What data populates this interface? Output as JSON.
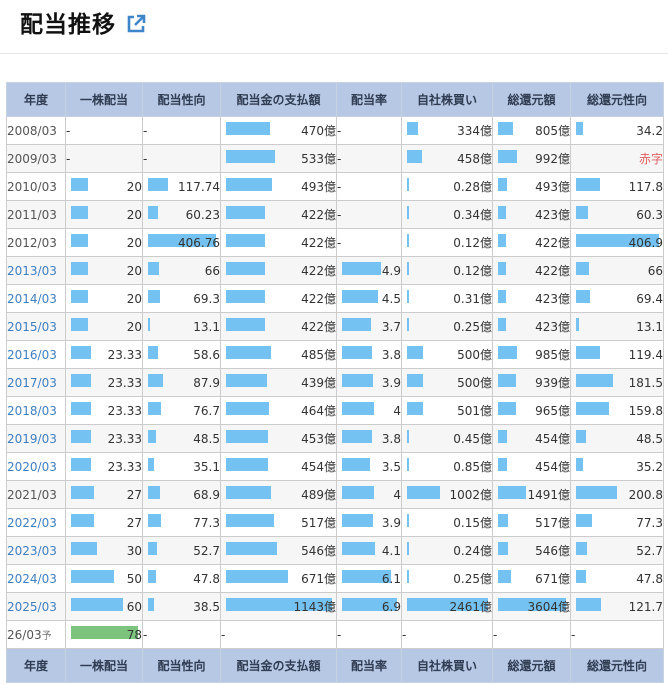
{
  "title": "配当推移",
  "headers": [
    "年度",
    "一株配当",
    "配当性向",
    "配当金の支払額",
    "配当率",
    "自社株買い",
    "総還元額",
    "総還元性向"
  ],
  "max": {
    "dps": 78,
    "payout": 406.76,
    "paid": 1143,
    "yield": 6.9,
    "buyback": 2461,
    "total": 3604,
    "tpayout": 406.9
  },
  "rows": [
    {
      "year": "2008/03",
      "link": false,
      "dps": "-",
      "payout": "-",
      "paid": "470億",
      "yield": "-",
      "buyback": "334億",
      "total": "805億",
      "tpayout": "34.2"
    },
    {
      "year": "2009/03",
      "link": false,
      "dps": "-",
      "payout": "-",
      "paid": "533億",
      "yield": "-",
      "buyback": "458億",
      "total": "992億",
      "tpayout": "赤字"
    },
    {
      "year": "2010/03",
      "link": false,
      "dps": "20",
      "payout": "117.74",
      "paid": "493億",
      "yield": "-",
      "buyback": "0.28億",
      "total": "493億",
      "tpayout": "117.8"
    },
    {
      "year": "2011/03",
      "link": false,
      "dps": "20",
      "payout": "60.23",
      "paid": "422億",
      "yield": "-",
      "buyback": "0.34億",
      "total": "423億",
      "tpayout": "60.3"
    },
    {
      "year": "2012/03",
      "link": false,
      "dps": "20",
      "payout": "406.76",
      "paid": "422億",
      "yield": "-",
      "buyback": "0.12億",
      "total": "422億",
      "tpayout": "406.9"
    },
    {
      "year": "2013/03",
      "link": true,
      "dps": "20",
      "payout": "66",
      "paid": "422億",
      "yield": "4.9",
      "buyback": "0.12億",
      "total": "422億",
      "tpayout": "66"
    },
    {
      "year": "2014/03",
      "link": true,
      "dps": "20",
      "payout": "69.3",
      "paid": "422億",
      "yield": "4.5",
      "buyback": "0.31億",
      "total": "423億",
      "tpayout": "69.4"
    },
    {
      "year": "2015/03",
      "link": true,
      "dps": "20",
      "payout": "13.1",
      "paid": "422億",
      "yield": "3.7",
      "buyback": "0.25億",
      "total": "423億",
      "tpayout": "13.1"
    },
    {
      "year": "2016/03",
      "link": true,
      "dps": "23.33",
      "payout": "58.6",
      "paid": "485億",
      "yield": "3.8",
      "buyback": "500億",
      "total": "985億",
      "tpayout": "119.4"
    },
    {
      "year": "2017/03",
      "link": true,
      "dps": "23.33",
      "payout": "87.9",
      "paid": "439億",
      "yield": "3.9",
      "buyback": "500億",
      "total": "939億",
      "tpayout": "181.5"
    },
    {
      "year": "2018/03",
      "link": true,
      "dps": "23.33",
      "payout": "76.7",
      "paid": "464億",
      "yield": "4",
      "buyback": "501億",
      "total": "965億",
      "tpayout": "159.8"
    },
    {
      "year": "2019/03",
      "link": true,
      "dps": "23.33",
      "payout": "48.5",
      "paid": "453億",
      "yield": "3.8",
      "buyback": "0.45億",
      "total": "454億",
      "tpayout": "48.5"
    },
    {
      "year": "2020/03",
      "link": true,
      "dps": "23.33",
      "payout": "35.1",
      "paid": "454億",
      "yield": "3.5",
      "buyback": "0.85億",
      "total": "454億",
      "tpayout": "35.2"
    },
    {
      "year": "2021/03",
      "link": false,
      "dps": "27",
      "payout": "68.9",
      "paid": "489億",
      "yield": "4",
      "buyback": "1002億",
      "total": "1491億",
      "tpayout": "200.8"
    },
    {
      "year": "2022/03",
      "link": true,
      "dps": "27",
      "payout": "77.3",
      "paid": "517億",
      "yield": "3.9",
      "buyback": "0.15億",
      "total": "517億",
      "tpayout": "77.3"
    },
    {
      "year": "2023/03",
      "link": true,
      "dps": "30",
      "payout": "52.7",
      "paid": "546億",
      "yield": "4.1",
      "buyback": "0.24億",
      "total": "546億",
      "tpayout": "52.7"
    },
    {
      "year": "2024/03",
      "link": true,
      "dps": "50",
      "payout": "47.8",
      "paid": "671億",
      "yield": "6.1",
      "buyback": "0.25億",
      "total": "671億",
      "tpayout": "47.8"
    },
    {
      "year": "2025/03",
      "link": true,
      "dps": "60",
      "payout": "38.5",
      "paid": "1143億",
      "yield": "6.9",
      "buyback": "2461億",
      "total": "3604億",
      "tpayout": "121.7"
    },
    {
      "year": "26/03",
      "year_suffix": "予",
      "link": false,
      "forecast": true,
      "dps": "78",
      "payout": "-",
      "paid": "-",
      "yield": "-",
      "buyback": "-",
      "total": "-",
      "tpayout": "-"
    }
  ]
}
